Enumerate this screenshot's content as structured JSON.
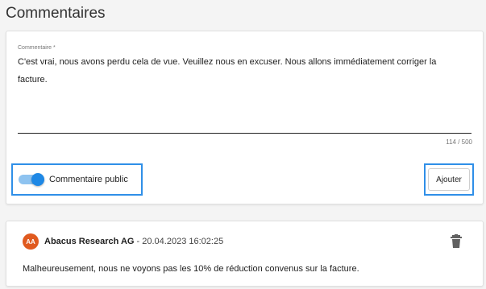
{
  "section": {
    "title": "Commentaires"
  },
  "comment_form": {
    "field_label": "Commentaire *",
    "value": "C'est vrai, nous avons perdu cela de vue. Veuillez nous en excuser. Nous allons immédiatement corriger la facture.",
    "counter": "114 / 500",
    "public_toggle": {
      "label": "Commentaire public",
      "checked": true
    },
    "add_button_label": "Ajouter"
  },
  "comments": [
    {
      "avatar_initials": "AA",
      "author": "Abacus Research AG",
      "separator": " - ",
      "timestamp": "20.04.2023 16:02:25",
      "text": "Malheureusement, nous ne voyons pas les 10% de réduction convenus sur la facture.",
      "delete_icon": "trash-icon"
    }
  ],
  "colors": {
    "accent": "#1e88e5",
    "highlight_border": "#2f8fe8",
    "avatar_bg": "#e05a1f"
  }
}
